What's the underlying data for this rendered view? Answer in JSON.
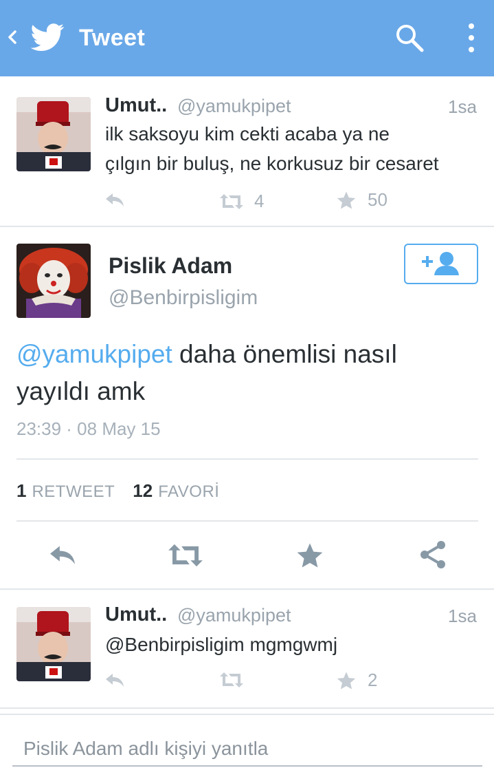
{
  "topbar": {
    "back_icon": "chevron-left-icon",
    "logo_icon": "twitter-bird-icon",
    "title": "Tweet",
    "search_icon": "search-icon",
    "more_icon": "more-vertical-icon",
    "background": "#69a8e8"
  },
  "tweets": [
    {
      "name": "Umut..",
      "handle": "@yamukpipet",
      "time": "1sa",
      "text_line1": "ilk saksoyu kim cekti acaba ya ne",
      "text_line2": "çılgın bir buluş, ne korkusuz bir cesaret",
      "retweets": "4",
      "favorites": "50"
    },
    {
      "name": "Umut..",
      "handle": "@yamukpipet",
      "time": "1sa",
      "text_line1": "@Benbirpisligim mgmgwmj",
      "retweets": "",
      "favorites": "2"
    }
  ],
  "main_tweet": {
    "name": "Pislik Adam",
    "handle": "@Benbirpisligim",
    "mention": "@yamukpipet",
    "text_rest": " daha önemlisi nasıl",
    "text_line2": "yayıldı amk",
    "timestamp": "23:39 · 08 May 15",
    "retweet_count": "1",
    "retweet_label": "RETWEET",
    "favorite_count": "12",
    "favorite_label": "FAVORİ",
    "follow_icon": "add-user-icon"
  },
  "reply_box": {
    "placeholder": "Pislik Adam adlı kişiyi yanıtla"
  },
  "colors": {
    "accent": "#55acee",
    "muted": "#9aa4ad",
    "text": "#292f33"
  }
}
